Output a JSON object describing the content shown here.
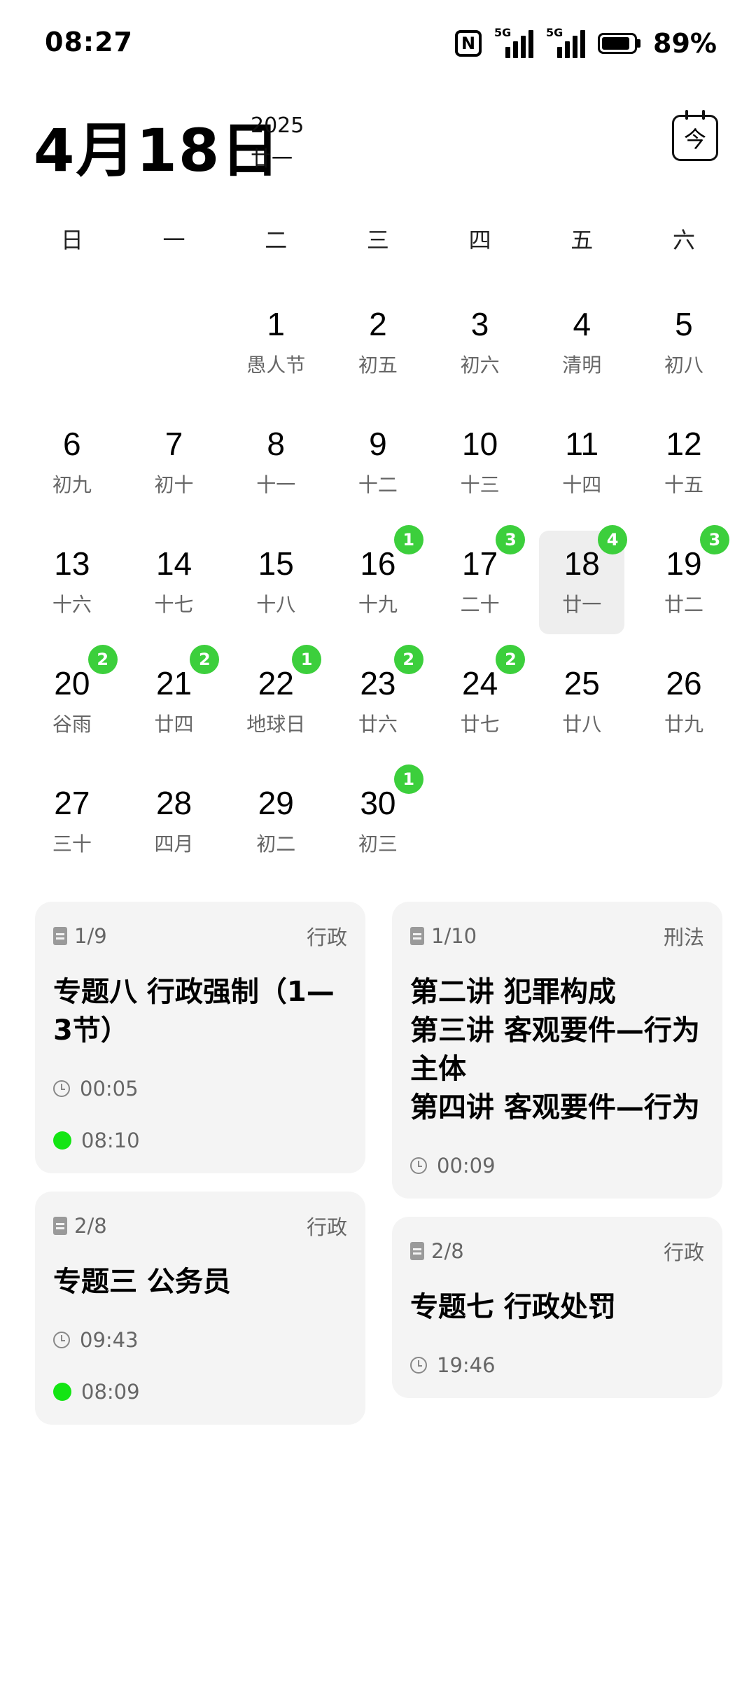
{
  "status": {
    "time": "08:27",
    "nfc": "N",
    "sim1": "5G",
    "sim2": "5G",
    "battery_text": "89%",
    "battery_level": 0.89
  },
  "header": {
    "date": "4月18日",
    "year": "2025",
    "lunar": "廿一",
    "today_label": "今"
  },
  "weekdays": [
    "日",
    "一",
    "二",
    "三",
    "四",
    "五",
    "六"
  ],
  "calendar": {
    "leading_blanks": 2,
    "selected_day": 18,
    "days": [
      {
        "n": "1",
        "l": "愚人节"
      },
      {
        "n": "2",
        "l": "初五"
      },
      {
        "n": "3",
        "l": "初六"
      },
      {
        "n": "4",
        "l": "清明"
      },
      {
        "n": "5",
        "l": "初八"
      },
      {
        "n": "6",
        "l": "初九"
      },
      {
        "n": "7",
        "l": "初十"
      },
      {
        "n": "8",
        "l": "十一"
      },
      {
        "n": "9",
        "l": "十二"
      },
      {
        "n": "10",
        "l": "十三"
      },
      {
        "n": "11",
        "l": "十四"
      },
      {
        "n": "12",
        "l": "十五"
      },
      {
        "n": "13",
        "l": "十六"
      },
      {
        "n": "14",
        "l": "十七"
      },
      {
        "n": "15",
        "l": "十八"
      },
      {
        "n": "16",
        "l": "十九",
        "b": "1"
      },
      {
        "n": "17",
        "l": "二十",
        "b": "3"
      },
      {
        "n": "18",
        "l": "廿一",
        "b": "4"
      },
      {
        "n": "19",
        "l": "廿二",
        "b": "3"
      },
      {
        "n": "20",
        "l": "谷雨",
        "b": "2"
      },
      {
        "n": "21",
        "l": "廿四",
        "b": "2"
      },
      {
        "n": "22",
        "l": "地球日",
        "b": "1"
      },
      {
        "n": "23",
        "l": "廿六",
        "b": "2"
      },
      {
        "n": "24",
        "l": "廿七",
        "b": "2"
      },
      {
        "n": "25",
        "l": "廿八"
      },
      {
        "n": "26",
        "l": "廿九"
      },
      {
        "n": "27",
        "l": "三十"
      },
      {
        "n": "28",
        "l": "四月"
      },
      {
        "n": "29",
        "l": "初二"
      },
      {
        "n": "30",
        "l": "初三",
        "b": "1"
      }
    ]
  },
  "cards_left": [
    {
      "progress": "1/9",
      "category": "行政",
      "title": "专题八  行政强制（1—3节）",
      "duration": "00:05",
      "time": "08:10"
    },
    {
      "progress": "2/8",
      "category": "行政",
      "title": "专题三 公务员",
      "duration": "09:43",
      "time": "08:09"
    }
  ],
  "cards_right": [
    {
      "progress": "1/10",
      "category": "刑法",
      "title": "第二讲  犯罪构成\n第三讲  客观要件—行为主体\n第四讲  客观要件—行为",
      "duration": "00:09"
    },
    {
      "progress": "2/8",
      "category": "行政",
      "title": "专题七  行政处罚",
      "duration": "19:46"
    }
  ]
}
